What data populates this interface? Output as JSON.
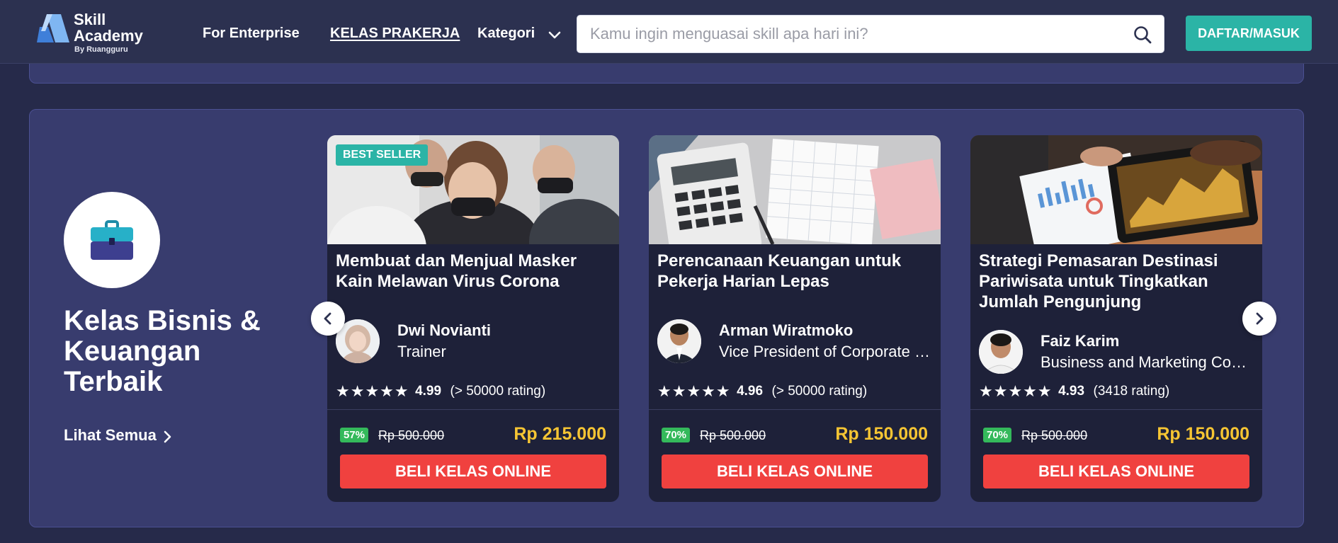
{
  "header": {
    "logo": {
      "line1": "Skill",
      "line2": "Academy",
      "sub": "By Ruangguru"
    },
    "nav": {
      "enterprise": "For Enterprise",
      "prakerja": "KELAS PRAKERJA",
      "kategori": "Kategori"
    },
    "search": {
      "placeholder": "Kamu ingin menguasai skill apa hari ini?",
      "value": ""
    },
    "auth_button": "DAFTAR/MASUK"
  },
  "section": {
    "title": "Kelas Bisnis & Keuangan Terbaik",
    "see_all": "Lihat Semua",
    "icon": "briefcase-icon"
  },
  "colors": {
    "accent_teal": "#2bb4a6",
    "buy_red": "#f0413f",
    "price_yellow": "#f6c533",
    "discount_green": "#34b95b",
    "panel_bg": "#383c6e",
    "card_bg": "#1e2139"
  },
  "courses": [
    {
      "badge": "BEST SELLER",
      "title": "Membuat dan Menjual Masker Kain Melawan Virus Corona",
      "trainer_name": "Dwi Novianti",
      "trainer_role": "Trainer",
      "stars": "★★★★★",
      "rating": "4.99",
      "rating_count": "(> 50000 rating)",
      "discount": "57%",
      "old_price": "Rp 500.000",
      "price": "Rp 215.000",
      "buy_label": "BELI KELAS ONLINE"
    },
    {
      "title": "Perencanaan Keuangan untuk Pekerja Harian Lepas",
      "trainer_name": "Arman Wiratmoko",
      "trainer_role": "Vice President of Corporate Finance",
      "stars": "★★★★★",
      "rating": "4.96",
      "rating_count": "(> 50000 rating)",
      "discount": "70%",
      "old_price": "Rp 500.000",
      "price": "Rp 150.000",
      "buy_label": "BELI KELAS ONLINE"
    },
    {
      "title": "Strategi Pemasaran Destinasi Pariwisata untuk Tingkatkan Jumlah Pengunjung",
      "trainer_name": "Faiz Karim",
      "trainer_role": "Business and Marketing Consultant",
      "stars": "★★★★★",
      "rating": "4.93",
      "rating_count": "(3418 rating)",
      "discount": "70%",
      "old_price": "Rp 500.000",
      "price": "Rp 150.000",
      "buy_label": "BELI KELAS ONLINE"
    }
  ]
}
